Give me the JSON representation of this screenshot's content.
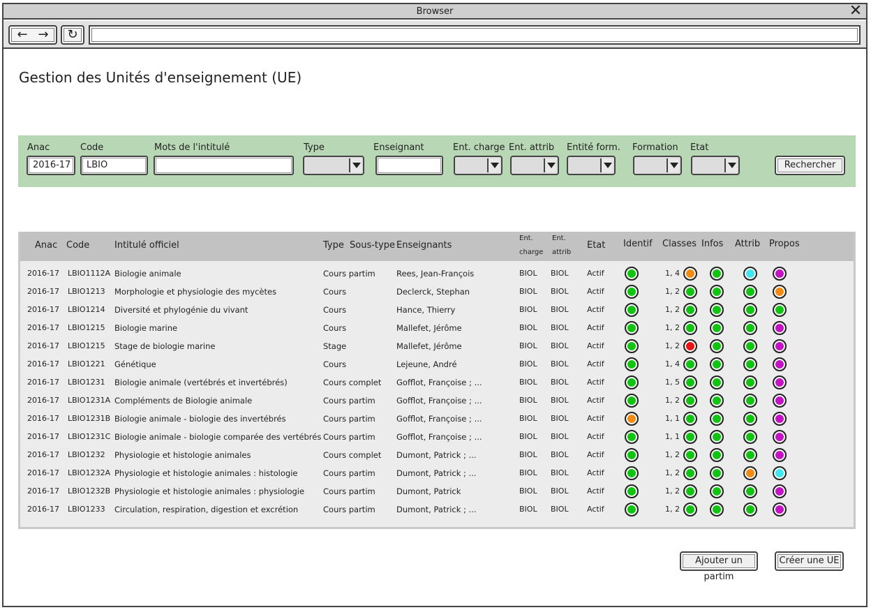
{
  "browser": {
    "title": "Browser",
    "close_icon": "close-icon",
    "back_icon": "←",
    "forward_icon": "→",
    "reload_icon": "↻",
    "address_value": ""
  },
  "page": {
    "title": "Gestion des Unités d'enseignement (UE)"
  },
  "filters": {
    "anac_label": "Anac",
    "anac_value": "2016-17",
    "code_label": "Code",
    "code_value": "LBIO",
    "intitule_label": "Mots de l'intitulé",
    "intitule_value": "",
    "type_label": "Type",
    "enseignant_label": "Enseignant",
    "enseignant_value": "",
    "ent_charge_label": "Ent. charge",
    "ent_attrib_label": "Ent. attrib",
    "entite_form_label": "Entité form.",
    "formation_label": "Formation",
    "etat_label": "Etat",
    "search_button": "Rechercher"
  },
  "table": {
    "headers": {
      "anac": "Anac",
      "code": "Code",
      "intitule": "Intitulé officiel",
      "type": "Type",
      "sous_type": "Sous-type",
      "enseignants": "Enseignants",
      "ent_charge_1": "Ent.",
      "ent_charge_2": "charge",
      "ent_attrib_1": "Ent.",
      "ent_attrib_2": "attrib",
      "etat": "Etat",
      "identif": "Identif",
      "classes": "Classes",
      "infos": "Infos",
      "attrib": "Attrib",
      "propos": "Propos"
    },
    "status_colors": {
      "green": "#11c411",
      "orange": "#f28a13",
      "cyan": "#3fe6f0",
      "purple": "#c413c4",
      "red": "#ee1111"
    },
    "rows": [
      {
        "anac": "2016-17",
        "code": "LBIO1112A",
        "intitule": "Biologie animale",
        "type": "Cours partim",
        "enseignants": "Rees, Jean-François",
        "ent_charge": "BIOL",
        "ent_attrib": "BIOL",
        "etat": "Actif",
        "identif": "green",
        "classes_text": "1, 4",
        "classes": "orange",
        "infos": "green",
        "attrib": "cyan",
        "propos": "purple"
      },
      {
        "anac": "2016-17",
        "code": "LBIO1213",
        "intitule": "Morphologie et physiologie des mycètes",
        "type": "Cours",
        "enseignants": "Declerck, Stephan",
        "ent_charge": "BIOL",
        "ent_attrib": "BIOL",
        "etat": "Actif",
        "identif": "green",
        "classes_text": "1, 2",
        "classes": "green",
        "infos": "green",
        "attrib": "green",
        "propos": "orange"
      },
      {
        "anac": "2016-17",
        "code": "LBIO1214",
        "intitule": "Diversité et phylogénie du vivant",
        "type": "Cours",
        "enseignants": "Hance, Thierry",
        "ent_charge": "BIOL",
        "ent_attrib": "BIOL",
        "etat": "Actif",
        "identif": "green",
        "classes_text": "1, 2",
        "classes": "green",
        "infos": "green",
        "attrib": "green",
        "propos": "green"
      },
      {
        "anac": "2016-17",
        "code": "LBIO1215",
        "intitule": "Biologie marine",
        "type": "Cours",
        "enseignants": "Mallefet, Jérôme",
        "ent_charge": "BIOL",
        "ent_attrib": "BIOL",
        "etat": "Actif",
        "identif": "green",
        "classes_text": "1, 2",
        "classes": "green",
        "infos": "green",
        "attrib": "green",
        "propos": "purple"
      },
      {
        "anac": "2016-17",
        "code": "LBIO1215",
        "intitule": "Stage de biologie marine",
        "type": "Stage",
        "enseignants": "Mallefet, Jérôme",
        "ent_charge": "BIOL",
        "ent_attrib": "BIOL",
        "etat": "Actif",
        "identif": "green",
        "classes_text": "1, 2",
        "classes": "red",
        "infos": "green",
        "attrib": "green",
        "propos": "purple"
      },
      {
        "anac": "2016-17",
        "code": "LBIO1221",
        "intitule": "Génétique",
        "type": "Cours",
        "enseignants": "Lejeune, André",
        "ent_charge": "BIOL",
        "ent_attrib": "BIOL",
        "etat": "Actif",
        "identif": "green",
        "classes_text": "1, 4",
        "classes": "green",
        "infos": "green",
        "attrib": "green",
        "propos": "purple"
      },
      {
        "anac": "2016-17",
        "code": "LBIO1231",
        "intitule": "Biologie animale (vertébrés et invertébrés)",
        "type": "Cours complet",
        "enseignants": "Gofflot, Françoise ; ...",
        "ent_charge": "BIOL",
        "ent_attrib": "BIOL",
        "etat": "Actif",
        "identif": "green",
        "classes_text": "1, 5",
        "classes": "green",
        "infos": "green",
        "attrib": "green",
        "propos": "purple"
      },
      {
        "anac": "2016-17",
        "code": "LBIO1231A",
        "intitule": "Compléments de Biologie animale",
        "type": "Cours partim",
        "enseignants": "Gofflot, Françoise ; ...",
        "ent_charge": "BIOL",
        "ent_attrib": "BIOL",
        "etat": "Actif",
        "identif": "green",
        "classes_text": "1, 2",
        "classes": "green",
        "infos": "green",
        "attrib": "green",
        "propos": "purple"
      },
      {
        "anac": "2016-17",
        "code": "LBIO1231B",
        "intitule": "Biologie animale - biologie des invertébrés",
        "type": "Cours partim",
        "enseignants": "Gofflot, Françoise ; ...",
        "ent_charge": "BIOL",
        "ent_attrib": "BIOL",
        "etat": "Actif",
        "identif": "orange",
        "classes_text": "1, 1",
        "classes": "green",
        "infos": "green",
        "attrib": "green",
        "propos": "purple"
      },
      {
        "anac": "2016-17",
        "code": "LBIO1231C",
        "intitule": "Biologie animale - biologie comparée des vertébrés",
        "type": "Cours partim",
        "enseignants": "Gofflot, Françoise ; ...",
        "ent_charge": "BIOL",
        "ent_attrib": "BIOL",
        "etat": "Actif",
        "identif": "green",
        "classes_text": "1, 1",
        "classes": "green",
        "infos": "green",
        "attrib": "green",
        "propos": "purple"
      },
      {
        "anac": "2016-17",
        "code": "LBIO1232",
        "intitule": "Physiologie et histologie animales",
        "type": "Cours complet",
        "enseignants": "Dumont, Patrick ; ...",
        "ent_charge": "BIOL",
        "ent_attrib": "BIOL",
        "etat": "Actif",
        "identif": "green",
        "classes_text": "1, 2",
        "classes": "green",
        "infos": "green",
        "attrib": "green",
        "propos": "purple"
      },
      {
        "anac": "2016-17",
        "code": "LBIO1232A",
        "intitule": "Physiologie et histologie animales : histologie",
        "type": "Cours partim",
        "enseignants": "Dumont, Patrick ; ...",
        "ent_charge": "BIOL",
        "ent_attrib": "BIOL",
        "etat": "Actif",
        "identif": "green",
        "classes_text": "1, 2",
        "classes": "green",
        "infos": "green",
        "attrib": "orange",
        "propos": "cyan"
      },
      {
        "anac": "2016-17",
        "code": "LBIO1232B",
        "intitule": "Physiologie et histologie animales : physiologie",
        "type": "Cours partim",
        "enseignants": "Dumont, Patrick",
        "ent_charge": "BIOL",
        "ent_attrib": "BIOL",
        "etat": "Actif",
        "identif": "green",
        "classes_text": "1, 2",
        "classes": "green",
        "infos": "green",
        "attrib": "green",
        "propos": "purple"
      },
      {
        "anac": "2016-17",
        "code": "LBIO1233",
        "intitule": " Circulation, respiration, digestion et excrétion",
        "type": "Cours partim",
        "enseignants": "Dumont, Patrick ; ...",
        "ent_charge": "BIOL",
        "ent_attrib": "BIOL",
        "etat": "Actif",
        "identif": "green",
        "classes_text": "1, 2",
        "classes": "green",
        "infos": "green",
        "attrib": "green",
        "propos": "purple"
      }
    ]
  },
  "actions": {
    "add_partim_button": "Ajouter un partim",
    "create_ue_button": "Créer une UE"
  }
}
